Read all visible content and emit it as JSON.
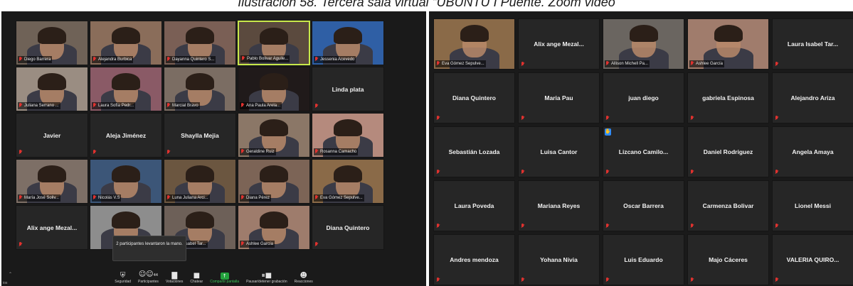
{
  "caption": "Ilustración 58. Tercera sala virtual “UBUNTU I Puente. Zoom video",
  "left_gallery": {
    "tiles": [
      {
        "name": "Diego Barrera",
        "video": true,
        "color": "#6f6257"
      },
      {
        "name": "Alejandra Burbica",
        "video": true,
        "color": "#8a6d5a"
      },
      {
        "name": "Dayanna Quintero S...",
        "video": true,
        "color": "#7a5f55"
      },
      {
        "name": "Pablo Bolivar Aguile...",
        "video": true,
        "color": "#5b4a3e",
        "active": true
      },
      {
        "name": "Jessenia Acevedo",
        "video": true,
        "color": "#2f5fa5"
      },
      {
        "name": "Juliana Serrano ...",
        "video": true,
        "color": "#9a8d82"
      },
      {
        "name": "Laura Sofía Pedr...",
        "video": true,
        "color": "#8a5a66"
      },
      {
        "name": "Marcial Bravo",
        "video": true,
        "color": "#7b6d63"
      },
      {
        "name": "Ana Paula Arela...",
        "video": true,
        "color": "#201a1a"
      },
      {
        "name": "Linda plata",
        "video": false
      },
      {
        "name": "Javier",
        "video": false
      },
      {
        "name": "Aleja Jiménez",
        "video": false
      },
      {
        "name": "Shaylla Mejia",
        "video": false
      },
      {
        "name": "Geraldine Ruiz",
        "video": true,
        "color": "#8b7767"
      },
      {
        "name": "Rosanna Camacho",
        "video": true,
        "color": "#b58a7d"
      },
      {
        "name": "María José Soliv...",
        "video": true,
        "color": "#7d6f66"
      },
      {
        "name": "Nicolás V.S",
        "video": true,
        "color": "#3c5678"
      },
      {
        "name": "Luna Juliana Arci...",
        "video": true,
        "color": "#6b5640"
      },
      {
        "name": "Diana Pérez",
        "video": true,
        "color": "#7c6456"
      },
      {
        "name": "Eva Gómez Sepulve...",
        "video": true,
        "color": "#8a6a48"
      },
      {
        "name": "Alix ange Mezal...",
        "video": false
      },
      {
        "name": "",
        "video": true,
        "color": "#8d8d8d"
      },
      {
        "name": "Laura Isabel Tar...",
        "video": true,
        "color": "#6d6058"
      },
      {
        "name": "Ashlee García",
        "video": true,
        "color": "#9e7c6c"
      },
      {
        "name": "Diana Quintero",
        "video": false
      }
    ],
    "toast": "2 participantes levantaron la mano.",
    "toolbar": {
      "security": "Seguridad",
      "participants": "Participantes",
      "participants_count": "44",
      "polls": "Votaciones",
      "chat": "Chatear",
      "share": "Compartir pantalla",
      "record": "Pausar/detener grabación",
      "reactions": "Reacciones"
    },
    "corner_label": "ios"
  },
  "right_gallery": {
    "tiles": [
      {
        "name": "Eva Gómez Sepulve...",
        "video": true,
        "color": "#8a6a48"
      },
      {
        "name": "Alix ange Mezal...",
        "video": false
      },
      {
        "name": "Allison Michell Pa...",
        "video": true,
        "color": "#6a6560"
      },
      {
        "name": "Ashlee García",
        "video": true,
        "color": "#a07c6c"
      },
      {
        "name": "Laura Isabel Tar...",
        "video": false
      },
      {
        "name": "Diana Quintero",
        "video": false
      },
      {
        "name": "Maria Pau",
        "video": false
      },
      {
        "name": "juan diego",
        "video": false
      },
      {
        "name": "gabriela Espinosa",
        "video": false
      },
      {
        "name": "Alejandro Ariza",
        "video": false
      },
      {
        "name": "Sebastián Lozada",
        "video": false
      },
      {
        "name": "Luisa Cantor",
        "video": false
      },
      {
        "name": "Lizcano  Camilo...",
        "video": false,
        "hand": true
      },
      {
        "name": "Daniel Rodriguez",
        "video": false
      },
      {
        "name": "Angela Amaya",
        "video": false
      },
      {
        "name": "Laura Poveda",
        "video": false
      },
      {
        "name": "Mariana Reyes",
        "video": false
      },
      {
        "name": "Oscar Barrera",
        "video": false
      },
      {
        "name": "Carmenza Bolivar",
        "video": false
      },
      {
        "name": "Lionel Messi",
        "video": false
      },
      {
        "name": "Andres mendoza",
        "video": false
      },
      {
        "name": "Yohana Nivia",
        "video": false
      },
      {
        "name": "Luis Eduardo",
        "video": false
      },
      {
        "name": "Majo Cáceres",
        "video": false
      },
      {
        "name": "VALERIA  QUIRO...",
        "video": false
      }
    ]
  }
}
